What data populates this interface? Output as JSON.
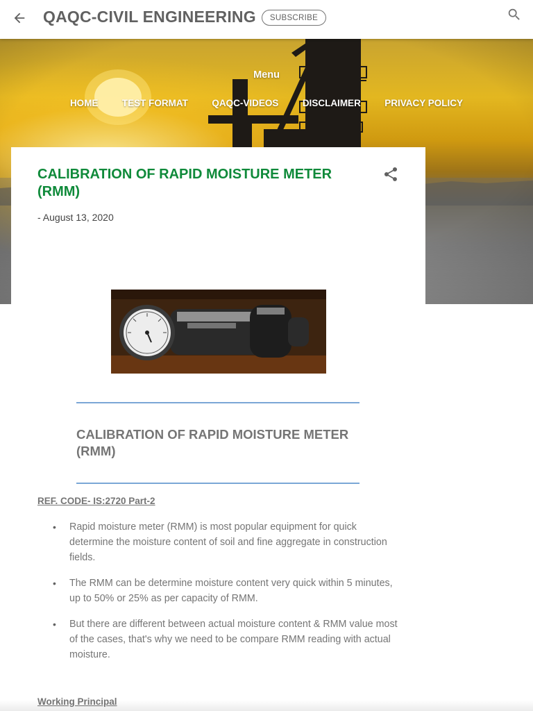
{
  "header": {
    "back_icon": "arrow-back-icon",
    "title": "QAQC-CIVIL ENGINEERING",
    "subscribe_label": "SUBSCRIBE",
    "search_icon": "search-icon"
  },
  "hero": {
    "menu_label": "Menu",
    "nav_items": [
      "HOME",
      "TEST FORMAT",
      "QAQC-VIDEOS",
      "DISCLAIMER",
      "PRIVACY POLICY"
    ]
  },
  "post": {
    "title": "CALIBRATION OF RAPID MOISTURE METER (RMM)",
    "date": "- August 13, 2020",
    "share_icon": "share-icon",
    "subtitle": "CALIBRATION OF RAPID MOISTURE METER (RMM)",
    "ref_code": "REF. CODE- IS:2720 Part-2",
    "bullets": [
      " Rapid moisture meter (RMM) is most popular equipment for quick determine the moisture content of soil and fine aggregate in construction fields.",
      " The RMM can be determine moisture content very quick within 5 minutes, up to 50% or 25% as per capacity of RMM.",
      " But there are different between actual moisture content & RMM value most of the cases, that's why we need to be compare RMM reading with actual moisture."
    ],
    "working_heading": "Working Principal"
  },
  "colors": {
    "title_green": "#0f8a3a",
    "text_grey": "#757575",
    "divider_blue": "#7aa7d6"
  }
}
